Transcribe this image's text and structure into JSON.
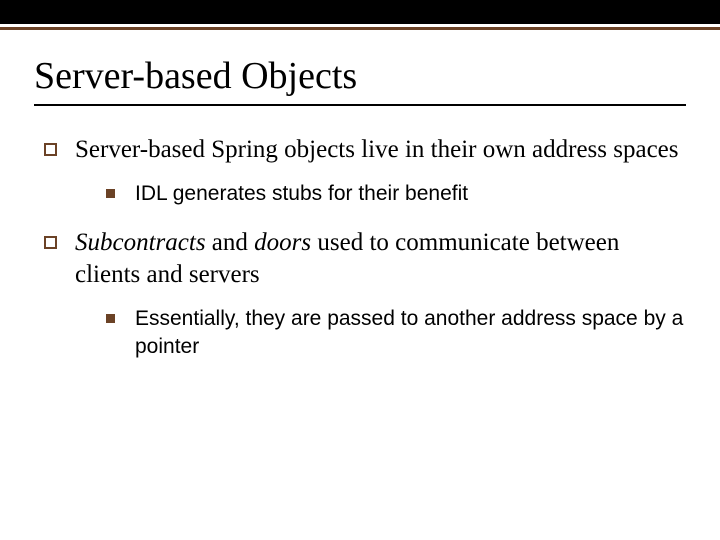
{
  "title": "Server-based Objects",
  "bullets": [
    {
      "text": "Server-based Spring objects live in their own address spaces",
      "sub": [
        {
          "text": "IDL generates stubs for their benefit"
        }
      ]
    },
    {
      "parts": [
        {
          "text": "Subcontracts",
          "italic": true
        },
        {
          "text": " and "
        },
        {
          "text": "doors",
          "italic": true
        },
        {
          "text": " used to communicate between clients and servers"
        }
      ],
      "sub": [
        {
          "text": "Essentially, they are passed to another address space by a pointer"
        }
      ]
    }
  ]
}
